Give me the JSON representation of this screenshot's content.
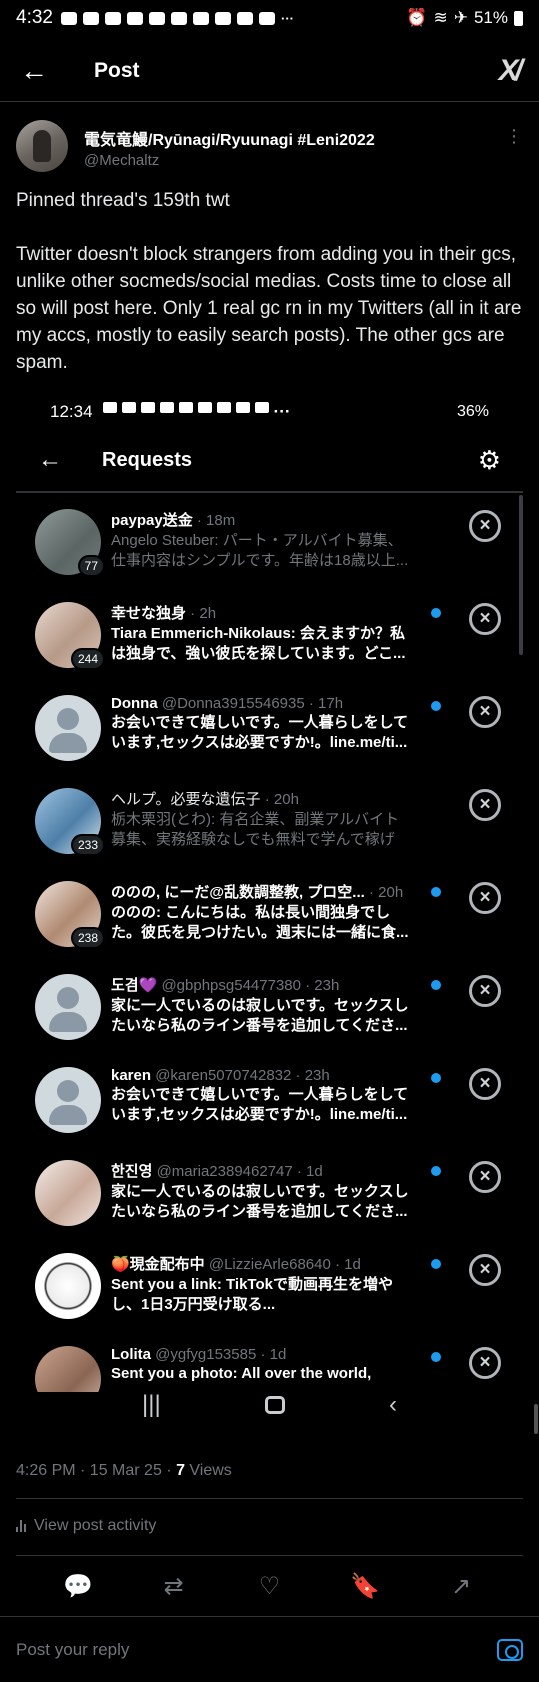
{
  "status_bar": {
    "time": "4:32",
    "dots": "···",
    "battery": "51%"
  },
  "header": {
    "back": "←",
    "title": "Post",
    "grok": "X/"
  },
  "author": {
    "name": "電気竜鰻/Ryūnagi/Ryuunagi #Leni2022",
    "handle": "@Mechaltz",
    "more": "⋮"
  },
  "post": {
    "p1": "Pinned thread's 159th twt",
    "p2": "Twitter doesn't block strangers from adding you in their gcs, unlike other socmeds/social medias. Costs time to close all so will post here. Only 1 real gc rn in my Twitters (all in it are my accs, mostly to easily search posts). The other gcs are spam."
  },
  "embedded": {
    "status": {
      "time": "12:34",
      "dots": "···",
      "battery": "36%"
    },
    "header": {
      "back": "←",
      "title": "Requests",
      "settings": "⚙"
    },
    "requests": [
      {
        "name": "paypay送金",
        "meta": " · 18m",
        "msg": "Angelo Steuber: パート・アルバイト募集、仕事内容はシンプルです。年齢は18歳以上...",
        "count": "77",
        "unread": false
      },
      {
        "name": "幸せな独身",
        "meta": " · 2h",
        "msg": "Tiara Emmerich-Nikolaus: 会えますか？私は独身で、強い彼氏を探しています。どこ...",
        "count": "244",
        "unread": true
      },
      {
        "name": "Donna",
        "meta": " @Donna3915546935 · 17h",
        "msg": "お会いできて嬉しいです。一人暮らしをしています,セックスは必要ですか!。line.me/ti...",
        "count": "",
        "unread": true
      },
      {
        "name": "ヘルプ。必要な遺伝子",
        "meta": " · 20h",
        "msg": "栃木栗羽(とわ): 有名企業、副業アルバイト募集、実務経験なしでも無料で学んで稼げる...",
        "count": "233",
        "unread": false
      },
      {
        "name": "ののの, にーだ@乱数調整教, プロ空...",
        "meta": " · 20h",
        "msg": "ののの: こんにちは。私は長い間独身でした。彼氏を見つけたい。週末には一緒に食...",
        "count": "238",
        "unread": true
      },
      {
        "name": "도겸💜",
        "meta": " @gbphpsg54477380 · 23h",
        "msg": "家に一人でいるのは寂しいです。セックスしたいなら私のライン番号を追加してくださ...",
        "count": "",
        "unread": true
      },
      {
        "name": "karen",
        "meta": " @karen5070742832 · 23h",
        "msg": "お会いできて嬉しいです。一人暮らしをしています,セックスは必要ですか!。line.me/ti...",
        "count": "",
        "unread": true
      },
      {
        "name": "한진영",
        "meta": " @maria2389462747 · 1d",
        "msg": "家に一人でいるのは寂しいです。セックスしたいなら私のライン番号を追加してくださ...",
        "count": "",
        "unread": true
      },
      {
        "name": "🍑現金配布中",
        "meta": " @LizzieArle68640 · 1d",
        "msg": "Sent you a link: TikTokで動画再生を増やし、1日3万円受け取る...",
        "count": "",
        "unread": true
      },
      {
        "name": "Lolita",
        "meta": " @ygfyg153585 · 1d",
        "msg": "Sent you a photo: All over the world,",
        "count": "",
        "unread": true
      }
    ],
    "nav": {
      "recents": "|||",
      "back": "‹"
    }
  },
  "footer": {
    "timestamp": "4:26 PM · 15 Mar 25 · ",
    "views_count": "7",
    "views_label": " Views",
    "activity": "View post activity",
    "reply_placeholder": "Post your reply"
  },
  "icons": {
    "reply": "💬",
    "repost": "⇄",
    "like": "♡",
    "bookmark": "🔖",
    "share": "↗"
  },
  "colors": {
    "accent": "#1d9bf0",
    "background": "#000000",
    "muted": "#71767b"
  }
}
